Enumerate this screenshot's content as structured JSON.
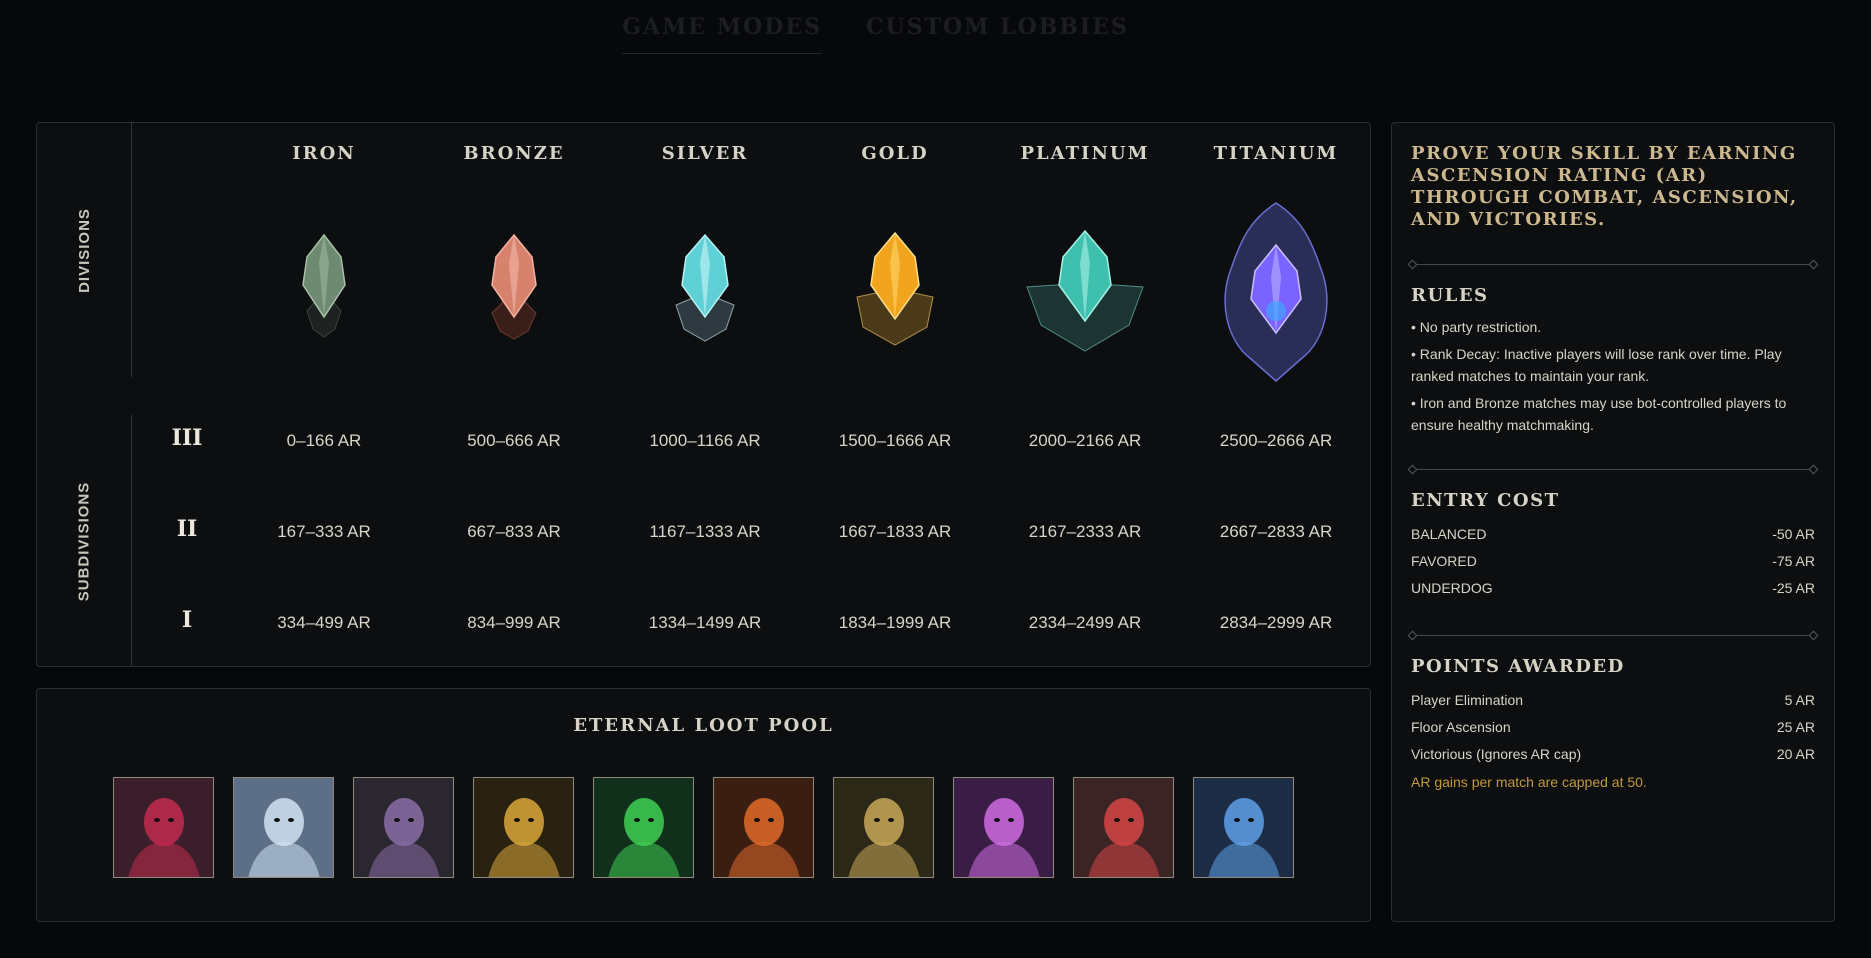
{
  "top_tabs": [
    {
      "label": "GAME MODES",
      "active": true
    },
    {
      "label": "CUSTOM LOBBIES",
      "active": false
    }
  ],
  "rank_table": {
    "divisions_label": "DIVISIONS",
    "subdivisions_label": "SUBDIVISIONS",
    "tiers": [
      {
        "name": "IRON",
        "color": "#6f8a72",
        "crest": "iron-crest-icon"
      },
      {
        "name": "BRONZE",
        "color": "#d7826d",
        "crest": "bronze-crest-icon"
      },
      {
        "name": "SILVER",
        "color": "#5fd0d6",
        "crest": "silver-crest-icon"
      },
      {
        "name": "GOLD",
        "color": "#f1a51f",
        "crest": "gold-crest-icon"
      },
      {
        "name": "PLATINUM",
        "color": "#3fbfad",
        "crest": "platinum-crest-icon"
      },
      {
        "name": "TITANIUM",
        "color": "#7b63ff",
        "crest": "titanium-crest-icon"
      }
    ],
    "subdivisions": [
      {
        "numeral": "III",
        "ranges": [
          "0–166 AR",
          "500–666 AR",
          "1000–1166 AR",
          "1500–1666 AR",
          "2000–2166 AR",
          "2500–2666 AR"
        ]
      },
      {
        "numeral": "II",
        "ranges": [
          "167–333 AR",
          "667–833 AR",
          "1167–1333 AR",
          "1667–1833 AR",
          "2167–2333 AR",
          "2667–2833 AR"
        ]
      },
      {
        "numeral": "I",
        "ranges": [
          "334–499 AR",
          "834–999 AR",
          "1334–1499 AR",
          "1834–1999 AR",
          "2334–2499 AR",
          "2834–2999 AR"
        ]
      }
    ]
  },
  "loot_pool": {
    "title": "ETERNAL LOOT POOL",
    "items": [
      {
        "icon": "rose-witch-portrait-icon",
        "bg": "#3a1f2a",
        "accent": "#c22a4f"
      },
      {
        "icon": "frost-maiden-portrait-icon",
        "bg": "#5d6f86",
        "accent": "#cfe2f2"
      },
      {
        "icon": "dark-rogue-portrait-icon",
        "bg": "#2b2730",
        "accent": "#8a6ea8"
      },
      {
        "icon": "golden-knight-portrait-icon",
        "bg": "#2a2210",
        "accent": "#d9a73a"
      },
      {
        "icon": "green-hood-portrait-icon",
        "bg": "#11301c",
        "accent": "#3fcf52"
      },
      {
        "icon": "lava-demon-portrait-icon",
        "bg": "#3a1e12",
        "accent": "#e06a2a"
      },
      {
        "icon": "gilded-skeleton-portrait-icon",
        "bg": "#2c2818",
        "accent": "#c9a858"
      },
      {
        "icon": "arcane-warlock-portrait-icon",
        "bg": "#3a1d45",
        "accent": "#d06be0"
      },
      {
        "icon": "crimson-blade-portrait-icon",
        "bg": "#3a2424",
        "accent": "#d74545"
      },
      {
        "icon": "blue-sentinel-portrait-icon",
        "bg": "#1c2c45",
        "accent": "#5ea0e6"
      }
    ]
  },
  "info_panel": {
    "intro": "PROVE YOUR SKILL BY EARNING ASCENSION RATING (AR) THROUGH COMBAT, ASCENSION, AND VICTORIES.",
    "rules": {
      "title": "RULES",
      "items": [
        "• No party restriction.",
        "• Rank Decay: Inactive players will lose rank over time. Play ranked matches to maintain your rank.",
        "• Iron and Bronze matches may use bot-controlled players to ensure healthy matchmaking."
      ]
    },
    "entry_cost": {
      "title": "ENTRY COST",
      "rows": [
        {
          "label": "BALANCED",
          "value": "-50 AR"
        },
        {
          "label": "FAVORED",
          "value": "-75 AR"
        },
        {
          "label": "UNDERDOG",
          "value": "-25 AR"
        }
      ]
    },
    "points_awarded": {
      "title": "POINTS AWARDED",
      "rows": [
        {
          "label": "Player Elimination",
          "value": "5 AR"
        },
        {
          "label": "Floor Ascension",
          "value": "25 AR"
        },
        {
          "label": "Victorious (Ignores AR cap)",
          "value": "20 AR"
        }
      ],
      "note": "AR gains per match are capped at 50."
    }
  }
}
